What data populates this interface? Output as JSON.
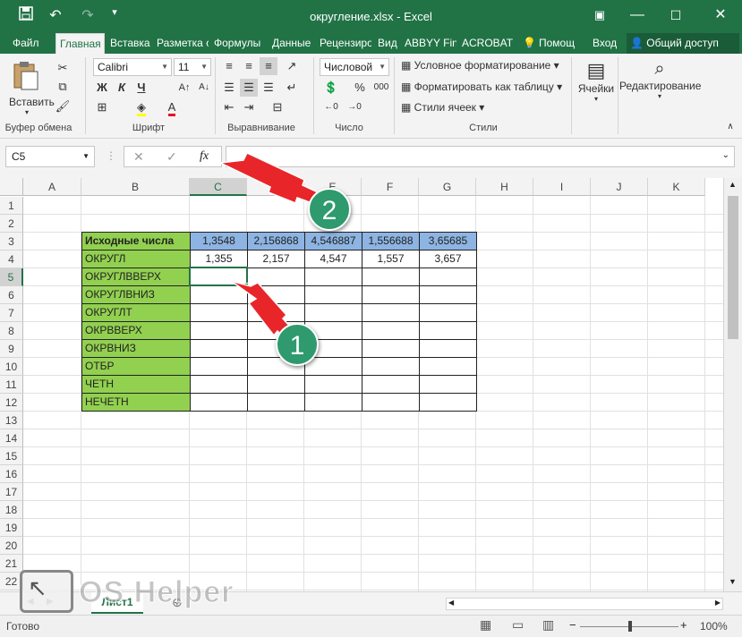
{
  "window": {
    "title": "округление.xlsx - Excel"
  },
  "quick_access": {
    "save_icon": "save-icon",
    "undo_icon": "undo-icon",
    "redo_icon": "redo-icon",
    "customize_icon": "chevron-down-icon"
  },
  "tabs": [
    {
      "label": "Файл"
    },
    {
      "label": "Главная"
    },
    {
      "label": "Вставка"
    },
    {
      "label": "Разметка с"
    },
    {
      "label": "Формулы"
    },
    {
      "label": "Данные"
    },
    {
      "label": "Рецензиро"
    },
    {
      "label": "Вид"
    },
    {
      "label": "ABBYY Fin"
    },
    {
      "label": "ACROBAT"
    },
    {
      "label": "Помощ"
    },
    {
      "label": "Вход"
    },
    {
      "label": "Общий доступ"
    }
  ],
  "ribbon": {
    "clipboard": {
      "paste_label": "Вставить",
      "group_label": "Буфер обмена"
    },
    "font": {
      "font_name": "Calibri",
      "font_size": "11",
      "bold": "Ж",
      "italic": "К",
      "underline": "Ч",
      "group_label": "Шрифт"
    },
    "alignment": {
      "group_label": "Выравнивание"
    },
    "number": {
      "format": "Числовой",
      "percent": "%",
      "thousands": "000",
      "group_label": "Число"
    },
    "styles": {
      "conditional": "Условное форматирование",
      "as_table": "Форматировать как таблицу",
      "cell_styles": "Стили ячеек",
      "group_label": "Стили"
    },
    "cells": {
      "label": "Ячейки"
    },
    "editing": {
      "label": "Редактирование"
    }
  },
  "formula_bar": {
    "name_box": "C5",
    "cancel": "✕",
    "enter": "✓",
    "fx": "fx",
    "formula": ""
  },
  "columns": [
    "A",
    "B",
    "C",
    "D",
    "E",
    "F",
    "G",
    "H",
    "I",
    "J",
    "K"
  ],
  "rows": [
    "1",
    "2",
    "3",
    "4",
    "5",
    "6",
    "7",
    "8",
    "9",
    "10",
    "11",
    "12",
    "13",
    "14",
    "15",
    "16",
    "17",
    "18",
    "19",
    "20",
    "21",
    "22"
  ],
  "table": {
    "header_label": "Исходные числа",
    "header_values": [
      "1,3548",
      "2,156868",
      "4,546887",
      "1,556688",
      "3,65685"
    ],
    "row4_label": "ОКРУГЛ",
    "row4_values": [
      "1,355",
      "2,157",
      "4,547",
      "1,557",
      "3,657"
    ],
    "labels": [
      "ОКРУГЛВВЕРХ",
      "ОКРУГЛВНИЗ",
      "ОКРУГЛТ",
      "ОКРВВЕРХ",
      "ОКРВНИЗ",
      "ОТБР",
      "ЧЕТН",
      "НЕЧЕТН"
    ]
  },
  "annotations": {
    "badge1": "1",
    "badge2": "2",
    "watermark": "OS Helper"
  },
  "sheet": {
    "tab": "Лист1"
  },
  "status": {
    "text": "Готово",
    "zoom": "100%"
  },
  "colors": {
    "excel_green": "#217346",
    "label_fill": "#92d050",
    "header_fill": "#8db4e2",
    "arrow": "#e8262a",
    "badge": "#2e9a6e"
  }
}
